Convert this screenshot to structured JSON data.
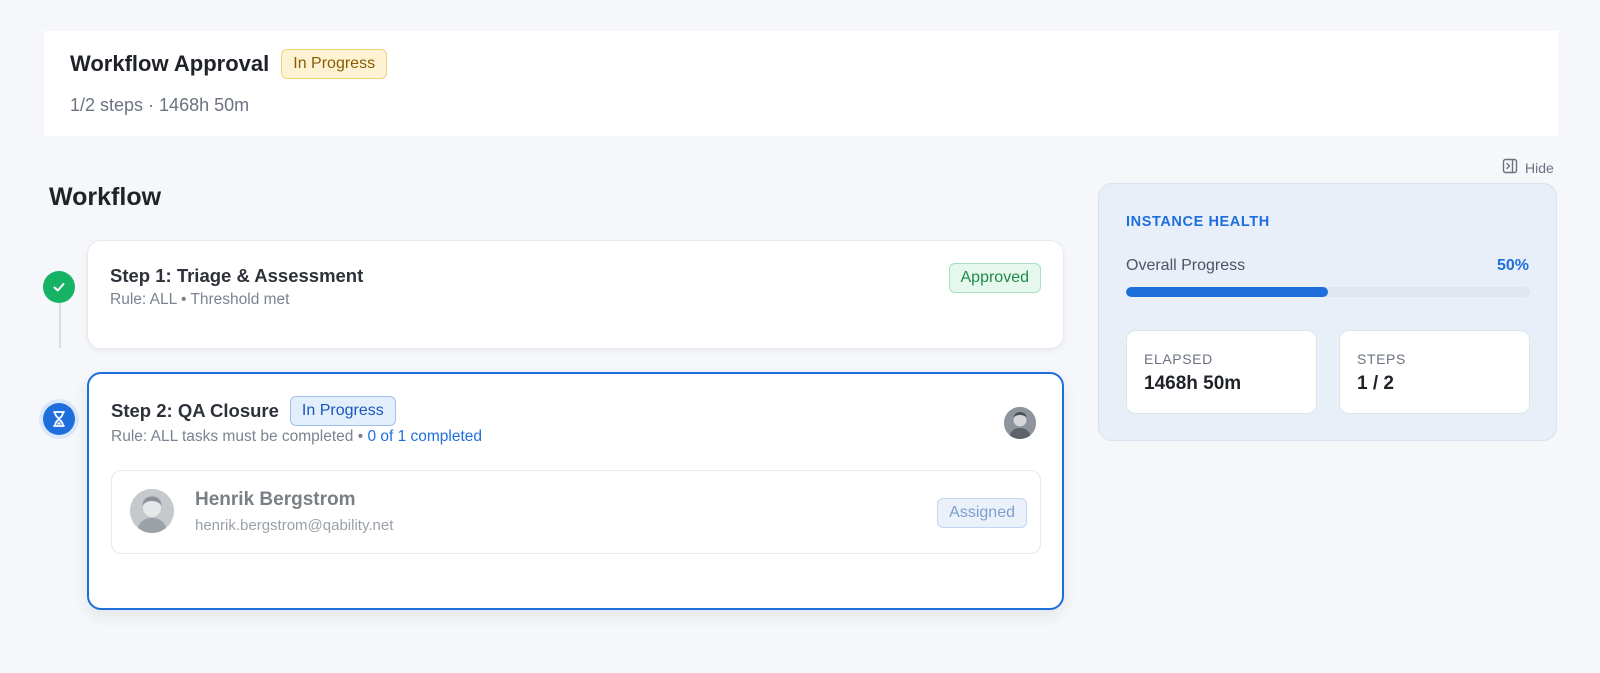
{
  "header": {
    "title": "Workflow Approval",
    "status_badge": "In Progress",
    "subtitle": "1/2 steps · 1468h 50m"
  },
  "workflow": {
    "section_title": "Workflow",
    "steps": [
      {
        "title": "Step 1: Triage & Assessment",
        "rule": "Rule: ALL • Threshold met",
        "status": "Approved",
        "status_icon": "check-icon"
      },
      {
        "title": "Step 2: QA Closure",
        "status_badge": "In Progress",
        "rule_prefix": "Rule: ALL tasks must be completed • ",
        "rule_progress": "0 of 1 completed",
        "status_icon": "hourglass-icon",
        "assignee": {
          "name": "Henrik Bergstrom",
          "email": "henrik.bergstrom@qability.net",
          "status": "Assigned"
        }
      }
    ]
  },
  "sidebar": {
    "hide_label": "Hide",
    "health": {
      "title": "INSTANCE HEALTH",
      "progress_label": "Overall Progress",
      "progress_value_text": "50%",
      "progress_fraction": 0.5,
      "elapsed_label": "ELAPSED",
      "elapsed_value": "1468h 50m",
      "steps_label": "STEPS",
      "steps_value": "1 / 2"
    }
  },
  "colors": {
    "accent": "#1e6fdc",
    "success": "#16b364",
    "warning_bg": "#fdf3d3"
  }
}
